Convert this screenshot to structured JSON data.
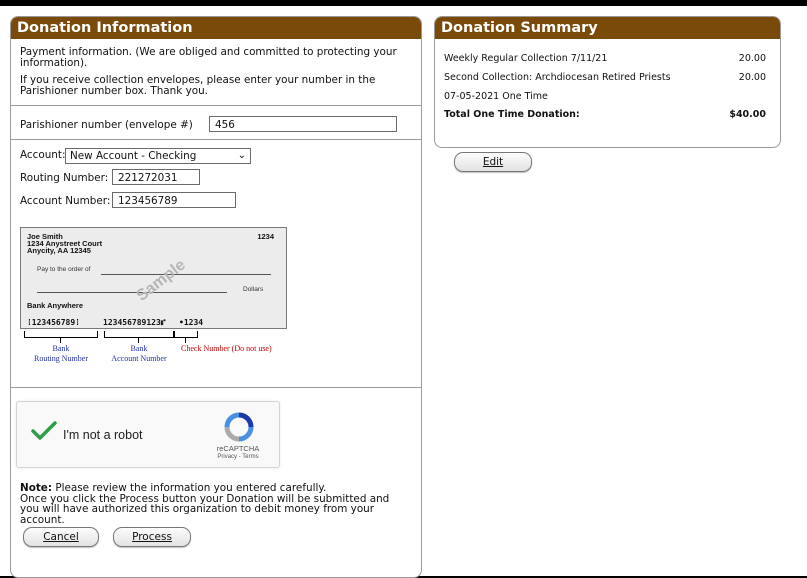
{
  "donation_info": {
    "title": "Donation Information",
    "payment_text": "Payment information. (We are obliged and committed to protecting your information).",
    "envelope_text": "If you receive collection envelopes, please enter your number in the Parishioner number box. Thank you.",
    "parishioner_label": "Parishioner number (envelope #)",
    "parishioner_value": "456",
    "account_label": "Account:",
    "account_selected": "New Account - Checking",
    "routing_label": "Routing Number:",
    "routing_value": "221272031",
    "account_number_label": "Account Number:",
    "account_number_value": "123456789",
    "check_sample": {
      "name": "Joe Smith",
      "address1": "1234 Anystreet Court",
      "address2": "Anycity, AA 12345",
      "check_no": "1234",
      "pay_to": "Pay to the order of",
      "dollars": "Dollars",
      "bank": "Bank Anywhere",
      "sample_watermark": "Sample",
      "micr_routing": "⁞123456789⁞",
      "micr_account": "123456789123⑈",
      "micr_check": "•1234",
      "caption_routing": "Bank\nRouting Number",
      "caption_account": "Bank\nAccount Number",
      "caption_check": "Check Number (Do not use)"
    },
    "recaptcha_label": "I'm not a robot",
    "recaptcha_brand": "reCAPTCHA",
    "recaptcha_terms": "Privacy - Terms",
    "note_bold": "Note:",
    "note_text1": " Please review the information you entered carefully.",
    "note_text2": "Once you click the Process button your Donation will be submitted and you will have authorized this organization to debit money from your account.",
    "cancel_label": "Cancel",
    "process_label": "Process"
  },
  "summary": {
    "title": "Donation Summary",
    "items": [
      {
        "label": "Weekly Regular Collection 7/11/21",
        "amount": "20.00"
      },
      {
        "label": "Second Collection: Archdiocesan Retired Priests",
        "amount": "20.00"
      }
    ],
    "schedule": "07-05-2021 One Time",
    "total_label": "Total One Time Donation:",
    "total_value": "$40.00",
    "edit_label": "Edit"
  },
  "colors": {
    "header_brown": "#7a4a0b",
    "routing_blue": "#1f2fa8",
    "check_red": "#c00000",
    "checkmark_green": "#2e9b48"
  }
}
